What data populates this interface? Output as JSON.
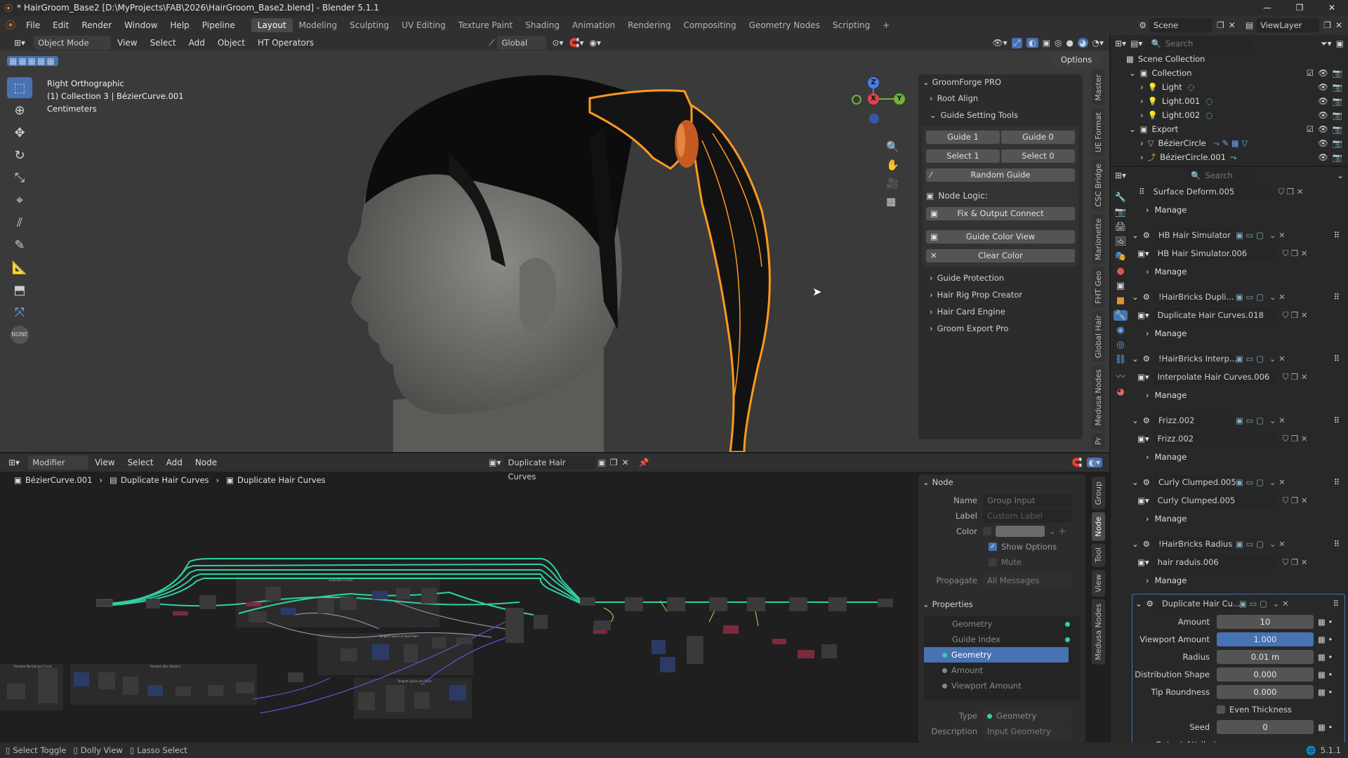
{
  "titlebar": {
    "title": "* HairGroom_Base2 [D:\\MyProjects\\FAB\\2026\\HairGroom_Base2.blend] - Blender 5.1.1"
  },
  "menu": [
    "File",
    "Edit",
    "Render",
    "Window",
    "Help",
    "Pipeline"
  ],
  "workspaces": [
    "Layout",
    "Modeling",
    "Sculpting",
    "UV Editing",
    "Texture Paint",
    "Shading",
    "Animation",
    "Rendering",
    "Compositing",
    "Geometry Nodes",
    "Scripting"
  ],
  "scene": {
    "label": "Scene",
    "viewlayer": "ViewLayer"
  },
  "viewport": {
    "mode": "Object Mode",
    "menus": [
      "View",
      "Select",
      "Add",
      "Object",
      "HT Operators"
    ],
    "transform": "Global",
    "options": "Options",
    "overlay_lines": [
      "Right Orthographic",
      "(1) Collection 3 | BézierCurve.001",
      "Centimeters"
    ],
    "gizmo": {
      "z": "Z",
      "y": "Y",
      "x": "X"
    }
  },
  "npanel": {
    "title": "GroomForge PRO",
    "root_align": "Root Align",
    "guide_tools": "Guide Setting Tools",
    "buttons": {
      "guide1": "Guide 1",
      "guide0": "Guide 0",
      "select1": "Select 1",
      "select0": "Select 0",
      "random": "Random Guide"
    },
    "node_logic": "Node Logic:",
    "fix_output": "Fix & Output Connect",
    "guide_color": "Guide Color View",
    "clear_color": "Clear Color",
    "sections": [
      "Guide Protection",
      "Hair Rig Prop Creator",
      "Hair Card Engine",
      "Groom Export Pro"
    ],
    "vtabs": [
      "Master",
      "UE Format",
      "CSC Bridge",
      "Marionette",
      "FHT Geo",
      "Global Hair",
      "Medusa Nodes",
      "Pr"
    ]
  },
  "node_editor": {
    "type": "Modifier",
    "menus": [
      "View",
      "Select",
      "Add",
      "Node"
    ],
    "tree_name": "Duplicate Hair Curves",
    "breadcrumb": [
      "BézierCurve.001",
      "Duplicate Hair Curves",
      "Duplicate Hair Curves"
    ],
    "frame_labels": [
      "Duplicate Curves",
      "Tangent Space at Root Point",
      "Random Normal per Curve",
      "Random Disc Position",
      "Tangent Space per Point"
    ],
    "vtabs": [
      "Group",
      "Node",
      "Tool",
      "View",
      "Medusa Nodes"
    ]
  },
  "node_panel": {
    "node_header": "Node",
    "name_label": "Name",
    "name_value": "Group Input",
    "label_label": "Label",
    "label_placeholder": "Custom Label",
    "color_label": "Color",
    "show_options": "Show Options",
    "mute": "Mute",
    "propagate_label": "Propagate",
    "propagate_value": "All Messages",
    "properties_header": "Properties",
    "props": [
      "Geometry",
      "Guide Index",
      "Geometry",
      "Amount",
      "Viewport Amount"
    ],
    "type_label": "Type",
    "type_value": "Geometry",
    "desc_label": "Description",
    "desc_value": "Input Geometry (Ma"
  },
  "outliner": {
    "search_placeholder": "Search",
    "root": "Scene Collection",
    "items": [
      {
        "label": "Collection",
        "depth": 1
      },
      {
        "label": "Light",
        "depth": 2
      },
      {
        "label": "Light.001",
        "depth": 2
      },
      {
        "label": "Light.002",
        "depth": 2
      },
      {
        "label": "Export",
        "depth": 1
      },
      {
        "label": "BézierCircle",
        "depth": 2
      },
      {
        "label": "BézierCircle.001",
        "depth": 2
      }
    ]
  },
  "properties": {
    "search_placeholder": "Search",
    "manage": "Manage",
    "modifiers": [
      {
        "name": "Surface Deform.005",
        "sub": null
      },
      {
        "name": "HB Hair Simulator",
        "sub": "HB Hair Simulator.006"
      },
      {
        "name": "!HairBricks Dupli...",
        "sub": "Duplicate Hair Curves.018"
      },
      {
        "name": "!HairBricks Interp...",
        "sub": "Interpolate Hair Curves.006"
      },
      {
        "name": "Frizz.002",
        "sub": "Frizz.002"
      },
      {
        "name": "Curly Clumped.005",
        "sub": "Curly Clumped.005"
      },
      {
        "name": "!HairBricks Radius",
        "sub": "hair raduis.006"
      }
    ],
    "active_modifier": "Duplicate Hair Cu...",
    "fields": [
      {
        "label": "Amount",
        "value": "10",
        "highlight": false
      },
      {
        "label": "Viewport Amount",
        "value": "1.000",
        "highlight": true
      },
      {
        "label": "Radius",
        "value": "0.01 m",
        "highlight": false
      },
      {
        "label": "Distribution Shape",
        "value": "0.000",
        "highlight": false
      },
      {
        "label": "Tip Roundness",
        "value": "0.000",
        "highlight": false
      }
    ],
    "even_thickness": "Even Thickness",
    "seed_label": "Seed",
    "seed_value": "0",
    "output_attributes": "Output Attributes"
  },
  "status": {
    "items": [
      "Select Toggle",
      "Dolly View",
      "Lasso Select"
    ],
    "version": "5.1.1"
  },
  "colors": {
    "accent": "#4772b3",
    "selection": "#ff9a1f",
    "node_link": "#2fd1a3"
  }
}
